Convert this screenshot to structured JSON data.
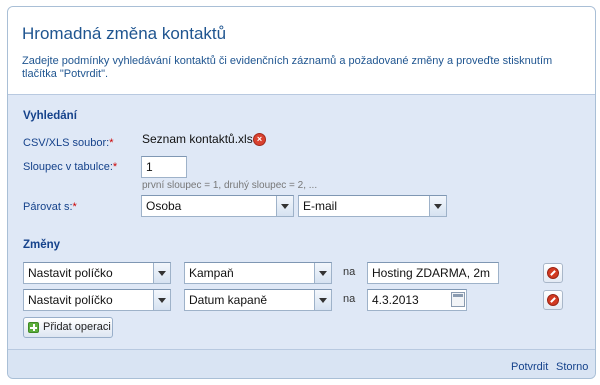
{
  "dialog": {
    "title": "Hromadná změna kontaktů",
    "description": "Zadejte podmínky vyhledávání kontaktů či evidenčních záznamů a požadované změny a proveďte stisknutím tlačítka \"Potvrdit\"."
  },
  "search": {
    "section_title": "Vyhledání",
    "file_label": "CSV/XLS soubor:",
    "file_required": "*",
    "file_name": "Seznam kontaktů.xls",
    "column_label": "Sloupec v tabulce:",
    "column_required": "*",
    "column_value": "1",
    "column_hint": "první sloupec = 1, druhý sloupec = 2, ...",
    "pair_label": "Párovat s:",
    "pair_required": "*",
    "pair_entity": "Osoba",
    "pair_field": "E-mail"
  },
  "changes": {
    "section_title": "Změny",
    "rows": [
      {
        "action": "Nastavit políčko",
        "field": "Kampaň",
        "connector": "na",
        "value": "Hosting ZDARMA, 2m"
      },
      {
        "action": "Nastavit políčko",
        "field": "Datum kapaně",
        "connector": "na",
        "value": "4.3.2013"
      }
    ],
    "add_label": "Přidat operaci"
  },
  "footer": {
    "confirm_label": "Potvrdit",
    "cancel_label": "Storno"
  },
  "icons": {
    "remove_file": "remove-file-icon",
    "remove_row": "remove-row-icon",
    "add": "add-icon",
    "calendar": "calendar-icon"
  },
  "colors": {
    "title": "#1f5590",
    "label": "#15428b",
    "required": "#cc0000",
    "panel_bg": "#dfe8f6"
  }
}
